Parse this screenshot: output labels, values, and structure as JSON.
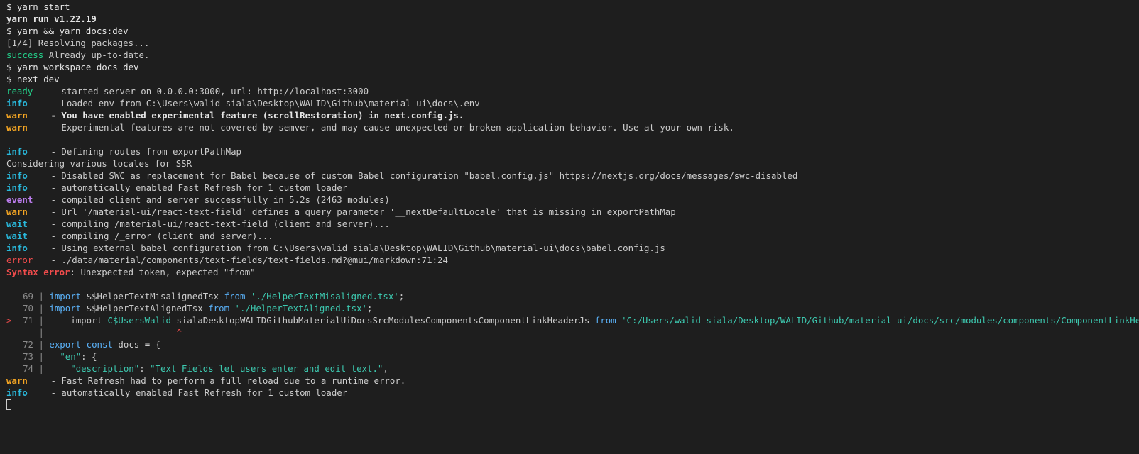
{
  "colors": {
    "background": "#1e1e1e",
    "foreground": "#cccccc",
    "success": "#23d18b",
    "info": "#29b8db",
    "warn": "#f5a623",
    "event": "#bc7dee",
    "error": "#f14c4c",
    "keyword": "#5ab0f6",
    "string": "#3dc9b0"
  },
  "header": {
    "cmd1": "$ yarn start",
    "yarn_version": "yarn run v1.22.19",
    "cmd2": "$ yarn && yarn docs:dev",
    "resolving": "[1/4] Resolving packages...",
    "success_label": "success",
    "success_text": " Already up-to-date.",
    "cmd3": "$ yarn workspace docs dev",
    "cmd4": "$ next dev"
  },
  "log": [
    {
      "level": "ready",
      "text": " - started server on 0.0.0.0:3000, url: http://localhost:3000"
    },
    {
      "level": "info",
      "text": " - Loaded env from C:\\Users\\walid siala\\Desktop\\WALID\\Github\\material-ui\\docs\\.env"
    },
    {
      "level": "warn",
      "text": " - You have enabled experimental feature (scrollRestoration) in next.config.js."
    },
    {
      "level": "warn",
      "text": " - Experimental features are not covered by semver, and may cause unexpected or broken application behavior. Use at your own risk."
    },
    {
      "level": "info",
      "text": " - Defining routes from exportPathMap"
    },
    {
      "plain": "Considering various locales for SSR"
    },
    {
      "level": "info",
      "text": " - Disabled SWC as replacement for Babel because of custom Babel configuration \"babel.config.js\" https://nextjs.org/docs/messages/swc-disabled"
    },
    {
      "level": "info",
      "text": " - automatically enabled Fast Refresh for 1 custom loader"
    },
    {
      "level": "event",
      "text": " - compiled client and server successfully in 5.2s (2463 modules)"
    },
    {
      "level": "warn",
      "text": " - Url '/material-ui/react-text-field' defines a query parameter '__nextDefaultLocale' that is missing in exportPathMap"
    },
    {
      "level": "wait",
      "text": " - compiling /material-ui/react-text-field (client and server)..."
    },
    {
      "level": "wait",
      "text": " - compiling /_error (client and server)..."
    },
    {
      "level": "info",
      "text": " - Using external babel configuration from C:\\Users\\walid siala\\Desktop\\WALID\\Github\\material-ui\\docs\\babel.config.js"
    },
    {
      "level": "error",
      "text": " - ./data/material/components/text-fields/text-fields.md?@mui/markdown:71:24"
    }
  ],
  "syntax_error": {
    "label": "Syntax error",
    "message": ": Unexpected token, expected \"from\""
  },
  "code": {
    "l69": {
      "num": "69",
      "kw": "import",
      "name": " $$HelperTextMisalignedTsx ",
      "from": "from",
      "src": "'./HelperTextMisaligned.tsx'",
      "end": ";"
    },
    "l70": {
      "num": "70",
      "kw": "import",
      "name": " $$HelperTextAlignedTsx ",
      "from": "from",
      "src": "'./HelperTextAligned.tsx'",
      "end": ";"
    },
    "l71": {
      "marker": ">",
      "num": "71",
      "indent": "    import ",
      "bad": "C$UsersWalid",
      "name": " sialaDesktopWALIDGithubMaterialUiDocsSrcModulesComponentsComponentLinkHeaderJs ",
      "from": "from",
      "src": "'C:/Users/walid siala/Desktop/WALID/Github/material-ui/docs/src/modules/components/ComponentLinkHeader.js'",
      "end": ";"
    },
    "caret": "^",
    "l72": {
      "num": "72",
      "kw1": "export",
      "kw2": "const",
      "rest": " docs = {"
    },
    "l73": {
      "num": "73",
      "indent": "  ",
      "key": "\"en\"",
      "rest": ": {"
    },
    "l74": {
      "num": "74",
      "indent": "    ",
      "key": "\"description\"",
      "sep": ": ",
      "val": "\"Text Fields let users enter and edit text.\"",
      "end": ","
    }
  },
  "footer": [
    {
      "level": "warn",
      "text": " - Fast Refresh had to perform a full reload due to a runtime error."
    },
    {
      "level": "info",
      "text": " - automatically enabled Fast Refresh for 1 custom loader"
    }
  ]
}
